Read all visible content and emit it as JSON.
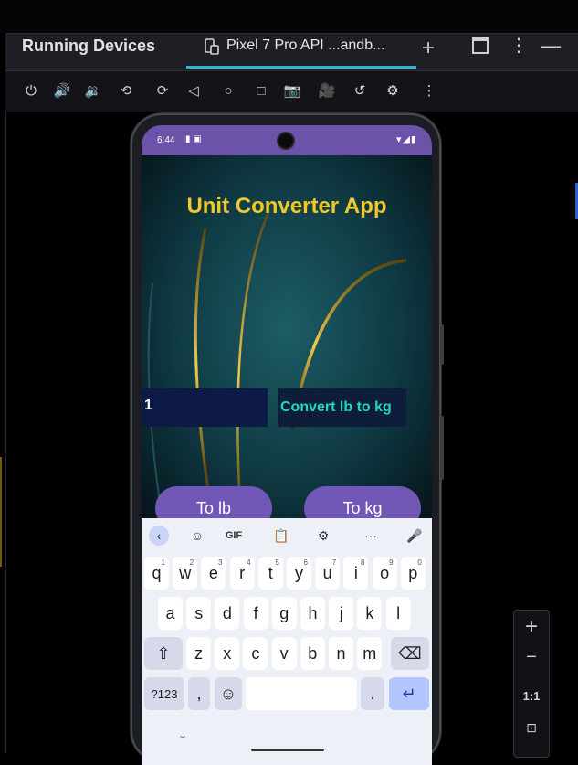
{
  "ide": {
    "panel_title": "Running Devices",
    "device_tab": "Pixel 7 Pro API ...andb...",
    "colors": {
      "accent": "#33b3d3",
      "panel_bg": "#1e1f24"
    },
    "toolbar": [
      {
        "name": "power-icon",
        "glyph": "⏻"
      },
      {
        "name": "volume-up-icon",
        "glyph": "🔊"
      },
      {
        "name": "volume-down-icon",
        "glyph": "🔉"
      },
      {
        "name": "rotate-left-icon",
        "glyph": "⟲"
      },
      {
        "name": "rotate-right-icon",
        "glyph": "⟳"
      },
      {
        "name": "back-icon",
        "glyph": "◁"
      },
      {
        "name": "home-icon",
        "glyph": "○"
      },
      {
        "name": "overview-icon",
        "glyph": "□"
      },
      {
        "name": "screenshot-icon",
        "glyph": "📷"
      },
      {
        "name": "screen-record-icon",
        "glyph": "🎥"
      },
      {
        "name": "snapshot-icon",
        "glyph": "↺"
      },
      {
        "name": "extended-controls-icon",
        "glyph": "⚙"
      },
      {
        "name": "more-options-icon",
        "glyph": "⋮"
      }
    ],
    "zoom": {
      "plus": "+",
      "minus": "−",
      "ratio": "1:1"
    }
  },
  "device": {
    "status": {
      "time": "6:44",
      "icons": "▾◢▮"
    },
    "app_title": "Unit Converter App",
    "input_value": "1",
    "convert_label": "Convert lb to kg",
    "buttons": {
      "to_lb": "To lb",
      "to_kg": "To kg"
    },
    "colors": {
      "title": "#f2c728",
      "convert_label": "#25d6b8",
      "button": "#7157b6",
      "statusbar": "#6a53a8"
    },
    "keyboard": {
      "toolbar": [
        "‹",
        "☺",
        "GIF",
        "📋",
        "⚙",
        "···",
        "🎤"
      ],
      "row1": [
        {
          "k": "q",
          "s": "1"
        },
        {
          "k": "w",
          "s": "2"
        },
        {
          "k": "e",
          "s": "3"
        },
        {
          "k": "r",
          "s": "4"
        },
        {
          "k": "t",
          "s": "5"
        },
        {
          "k": "y",
          "s": "6"
        },
        {
          "k": "u",
          "s": "7"
        },
        {
          "k": "i",
          "s": "8"
        },
        {
          "k": "o",
          "s": "9"
        },
        {
          "k": "p",
          "s": "0"
        }
      ],
      "row2": [
        "a",
        "s",
        "d",
        "f",
        "g",
        "h",
        "j",
        "k",
        "l"
      ],
      "row3": [
        "⇧",
        "z",
        "x",
        "c",
        "v",
        "b",
        "n",
        "m",
        "⌫"
      ],
      "row4": {
        "sym": "?123",
        "comma": ",",
        "emoji": "☺",
        "period": ".",
        "enter": "↵"
      }
    }
  }
}
